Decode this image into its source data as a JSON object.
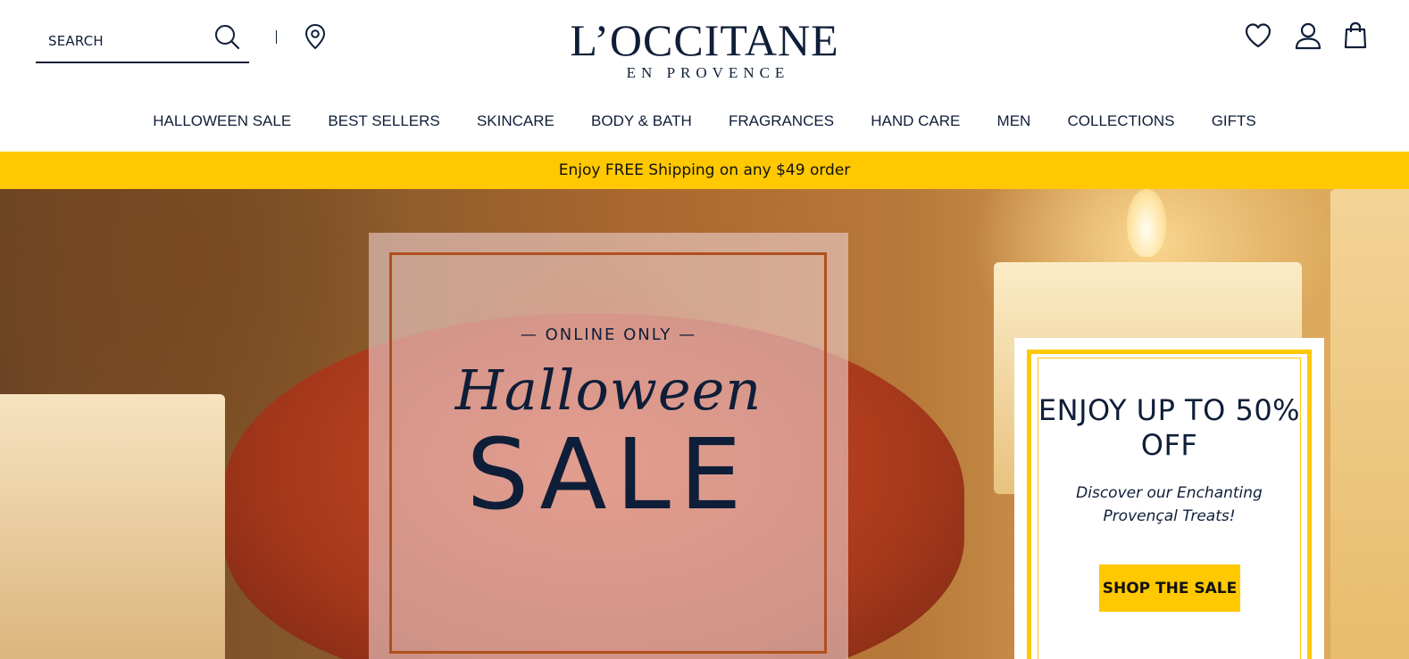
{
  "header": {
    "search": {
      "placeholder": "SEARCH"
    },
    "logo": {
      "main": "L’OCCITANE",
      "sub": "EN PROVENCE"
    },
    "icons": {
      "search": "search-icon",
      "store_locator": "map-pin-icon",
      "wishlist": "heart-icon",
      "account": "account-icon",
      "bag": "shopping-bag-icon"
    }
  },
  "nav": {
    "items": [
      {
        "label": "HALLOWEEN SALE"
      },
      {
        "label": "BEST SELLERS"
      },
      {
        "label": "SKINCARE"
      },
      {
        "label": "BODY & BATH"
      },
      {
        "label": "FRAGRANCES"
      },
      {
        "label": "HAND CARE"
      },
      {
        "label": "MEN"
      },
      {
        "label": "COLLECTIONS"
      },
      {
        "label": "GIFTS"
      }
    ]
  },
  "promo": {
    "text": "Enjoy FREE Shipping on any $49 order"
  },
  "hero": {
    "tagline": "— ONLINE ONLY —",
    "script_title": "Halloween",
    "sale_title": "SALE",
    "offer": {
      "heading": "ENJOY UP TO 50% OFF",
      "text": "Discover our Enchanting Provençal Treats!",
      "button_label": "SHOP THE SALE"
    }
  },
  "colors": {
    "brand_navy": "#0f1e38",
    "accent_yellow": "#ffc800"
  }
}
